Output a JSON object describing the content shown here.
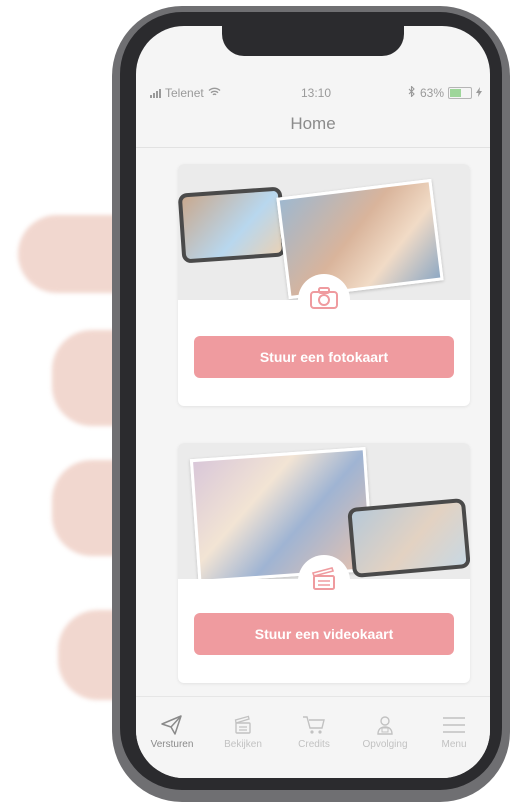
{
  "status_bar": {
    "carrier": "Telenet",
    "time": "13:10",
    "battery_percent": "63%",
    "battery_level": 0.63
  },
  "header": {
    "title": "Home"
  },
  "cards": [
    {
      "button_label": "Stuur een fotokaart",
      "icon": "camera-icon"
    },
    {
      "button_label": "Stuur een videokaart",
      "icon": "clapperboard-icon"
    }
  ],
  "tabbar": {
    "tabs": [
      {
        "label": "Versturen",
        "icon": "paper-plane-icon",
        "active": true
      },
      {
        "label": "Bekijken",
        "icon": "film-clapper-icon",
        "active": false
      },
      {
        "label": "Credits",
        "icon": "shopping-cart-icon",
        "active": false
      },
      {
        "label": "Opvolging",
        "icon": "person-icon",
        "active": false
      },
      {
        "label": "Menu",
        "icon": "hamburger-icon",
        "active": false
      }
    ]
  },
  "colors": {
    "accent": "#ef9b9f",
    "background": "#f5f5f5"
  }
}
